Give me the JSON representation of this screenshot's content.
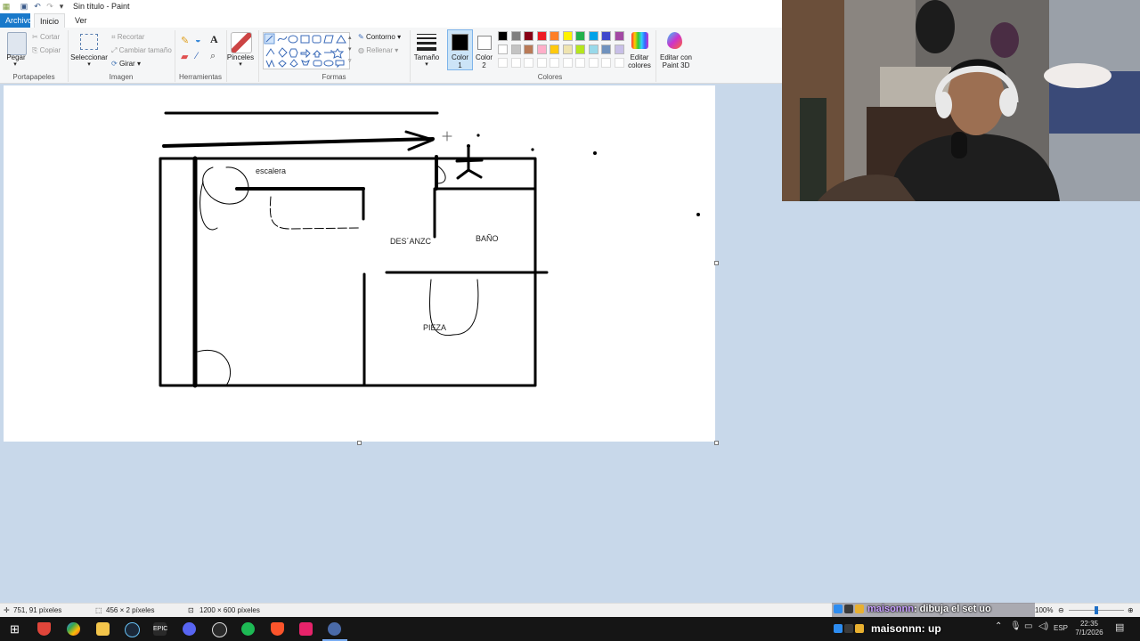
{
  "window": {
    "title": "Sin título - Paint"
  },
  "tabs": [
    "Archivo",
    "Inicio",
    "Ver"
  ],
  "ribbon": {
    "portapapeles": {
      "label": "Portapapeles",
      "pegar": "Pegar",
      "cortar": "Cortar",
      "copiar": "Copiar"
    },
    "imagen": {
      "label": "Imagen",
      "seleccionar": "Seleccionar",
      "recortar": "Recortar",
      "cambiar_tamano": "Cambiar tamaño",
      "girar": "Girar"
    },
    "herramientas": {
      "label": "Herramientas"
    },
    "pinceles": "Pinceles",
    "formas": {
      "label": "Formas",
      "contorno": "Contorno",
      "rellenar": "Rellenar"
    },
    "tamano": "Tamaño",
    "color1": {
      "line1": "Color",
      "line2": "1"
    },
    "color2": {
      "line1": "Color",
      "line2": "2"
    },
    "colores": {
      "label": "Colores",
      "row1": [
        "#000000",
        "#7f7f7f",
        "#880015",
        "#ed1c24",
        "#ff7f27",
        "#fff200",
        "#22b14c",
        "#00a2e8",
        "#3f48cc",
        "#a349a4"
      ],
      "row2": [
        "#ffffff",
        "#c3c3c3",
        "#b97a57",
        "#ffaec9",
        "#ffc90e",
        "#efe4b0",
        "#b5e61d",
        "#99d9ea",
        "#7092be",
        "#c8bfe7"
      ]
    },
    "editar_colores": {
      "line1": "Editar",
      "line2": "colores"
    },
    "paint3d": {
      "line1": "Editar con",
      "line2": "Paint 3D"
    }
  },
  "drawing": {
    "labels": {
      "escalera": "escalera",
      "descanzo": "DES´ANZC",
      "bano": "BAÑO",
      "pieza": "PIEZA"
    }
  },
  "statusbar": {
    "cursor": "751, 91 píxeles",
    "selection": "456 × 2 píxeles",
    "image_size": "1200 × 600 píxeles",
    "zoom": "100%"
  },
  "chat": {
    "msg1_user": "maisonnn",
    "msg1_text": ": dibuja el set uo",
    "msg2_user": "maisonnn",
    "msg2_text": ": up"
  },
  "tray": {
    "lang": "ESP",
    "time": "22:35",
    "date": "7/1/2026"
  }
}
